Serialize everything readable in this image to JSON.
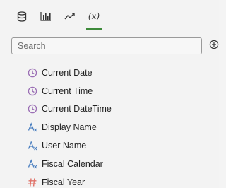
{
  "toolbar": {
    "tabs": [
      {
        "icon": "database-icon",
        "active": false
      },
      {
        "icon": "bar-chart-icon",
        "active": false
      },
      {
        "icon": "trend-line-icon",
        "active": false
      },
      {
        "icon": "function-icon",
        "label": "(x)",
        "active": true
      }
    ]
  },
  "search": {
    "placeholder": "Search",
    "value": ""
  },
  "colors": {
    "accent": "#3d8a3a",
    "date_icon": "#9b6fb5",
    "text_icon": "#4a7fc0",
    "number_icon": "#e0736a"
  },
  "items": [
    {
      "label": "Current Date",
      "icon": "clock-icon"
    },
    {
      "label": "Current Time",
      "icon": "clock-icon"
    },
    {
      "label": "Current DateTime",
      "icon": "clock-icon"
    },
    {
      "label": "Display Name",
      "icon": "text-attribute-icon"
    },
    {
      "label": "User Name",
      "icon": "text-attribute-icon"
    },
    {
      "label": "Fiscal Calendar",
      "icon": "text-attribute-icon"
    },
    {
      "label": "Fiscal Year",
      "icon": "number-attribute-icon"
    }
  ]
}
